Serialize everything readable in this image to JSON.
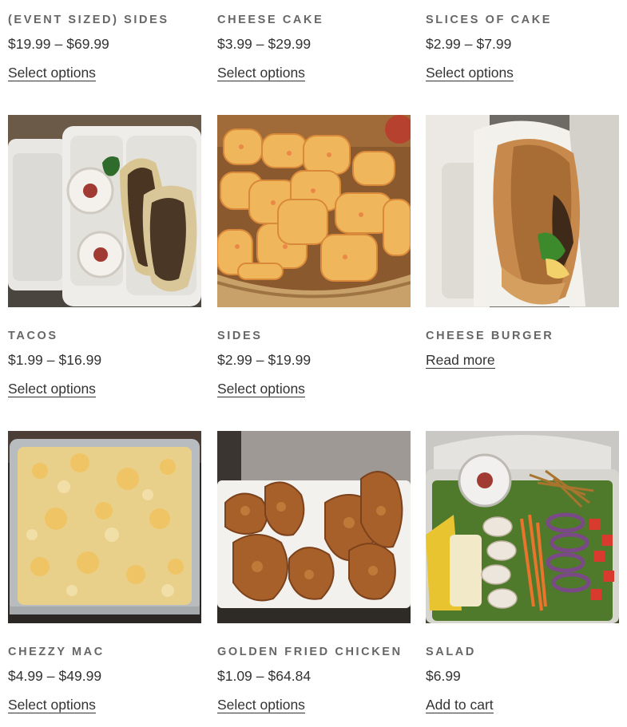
{
  "products": [
    {
      "title": "(EVENT SIZED) SIDES",
      "price_low": "$19.99",
      "price_high": "$69.99",
      "price_sep": "–",
      "action": "Select options",
      "image": "none"
    },
    {
      "title": "CHEESE CAKE",
      "price_low": "$3.99",
      "price_high": "$29.99",
      "price_sep": "–",
      "action": "Select options",
      "image": "none"
    },
    {
      "title": "SLICES OF CAKE",
      "price_low": "$2.99",
      "price_high": "$7.99",
      "price_sep": "–",
      "action": "Select options",
      "image": "none"
    },
    {
      "title": "TACOS",
      "price_low": "$1.99",
      "price_high": "$16.99",
      "price_sep": "–",
      "action": "Select options",
      "image": "tacos-photo"
    },
    {
      "title": "SIDES",
      "price_low": "$2.99",
      "price_high": "$19.99",
      "price_sep": "–",
      "action": "Select options",
      "image": "tater-tots-photo"
    },
    {
      "title": "CHEESE BURGER",
      "price_low": "",
      "price_high": "",
      "price_sep": "",
      "action": "Read more",
      "image": "cheese-burger-photo"
    },
    {
      "title": "CHEZZY MAC",
      "price_low": "$4.99",
      "price_high": "$49.99",
      "price_sep": "–",
      "action": "Select options",
      "image": "mac-and-cheese-photo"
    },
    {
      "title": "GOLDEN FRIED CHICKEN",
      "price_low": "$1.09",
      "price_high": "$64.84",
      "price_sep": "–",
      "action": "Select options",
      "image": "fried-chicken-photo"
    },
    {
      "title": "SALAD",
      "price_low": "$6.99",
      "price_high": "",
      "price_sep": "",
      "action": "Add to cart",
      "image": "salad-photo"
    }
  ],
  "colors": {
    "title": "#666666",
    "text": "#333333",
    "background": "#ffffff"
  }
}
